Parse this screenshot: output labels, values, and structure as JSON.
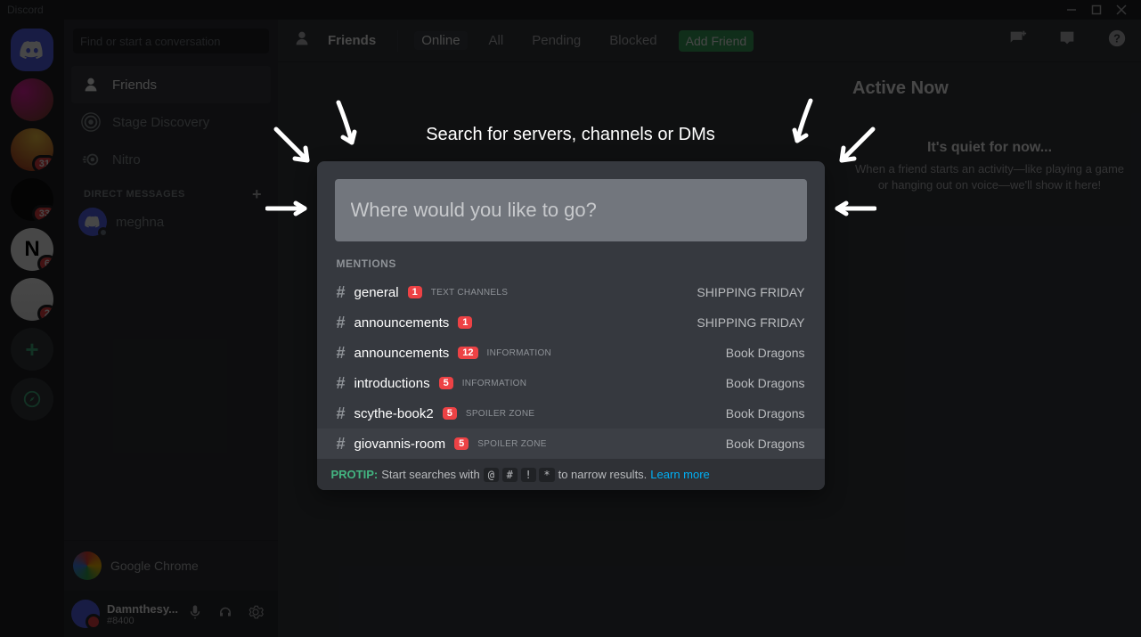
{
  "titlebar": {
    "app_name": "Discord"
  },
  "guilds": [
    {
      "type": "home",
      "badge": null
    },
    {
      "type": "avatar1",
      "badge": null
    },
    {
      "type": "avatar2",
      "badge": "31"
    },
    {
      "type": "avatar-b",
      "label": "",
      "badge": "33"
    },
    {
      "type": "avatar-c",
      "label": "N",
      "badge": "6"
    },
    {
      "type": "stack",
      "badge": "2"
    },
    {
      "type": "add",
      "label": "+"
    },
    {
      "type": "explore",
      "label": ""
    }
  ],
  "sidebar": {
    "search_placeholder": "Find or start a conversation",
    "items": [
      {
        "label": "Friends",
        "selected": true,
        "icon": "friends"
      },
      {
        "label": "Stage Discovery",
        "selected": false,
        "icon": "stage"
      },
      {
        "label": "Nitro",
        "selected": false,
        "icon": "nitro"
      }
    ],
    "dm_header": "DIRECT MESSAGES",
    "dms": [
      {
        "name": "meghna"
      }
    ],
    "activity": {
      "label": "Google Chrome"
    },
    "user": {
      "name": "Damnthesy...",
      "tag": "#8400"
    }
  },
  "toolbar": {
    "title": "Friends",
    "tabs": [
      {
        "label": "Online",
        "active": true
      },
      {
        "label": "All",
        "active": false
      },
      {
        "label": "Pending",
        "active": false
      },
      {
        "label": "Blocked",
        "active": false
      }
    ],
    "add_friend": "Add Friend"
  },
  "right": {
    "heading": "Active Now",
    "quiet_title": "It's quiet for now...",
    "quiet_desc": "When a friend starts an activity—like playing a game or hanging out on voice—we'll show it here!"
  },
  "modal": {
    "title": "Search for servers, channels or DMs",
    "placeholder": "Where would you like to go?",
    "section_label": "MENTIONS",
    "results": [
      {
        "name": "general",
        "badge": "1",
        "category": "TEXT CHANNELS",
        "server": "SHIPPING FRIDAY"
      },
      {
        "name": "announcements",
        "badge": "1",
        "category": "",
        "server": "SHIPPING FRIDAY"
      },
      {
        "name": "announcements",
        "badge": "12",
        "category": "INFORMATION",
        "server": "Book Dragons"
      },
      {
        "name": "introductions",
        "badge": "5",
        "category": "INFORMATION",
        "server": "Book Dragons"
      },
      {
        "name": "scythe-book2",
        "badge": "5",
        "category": "SPOILER ZONE",
        "server": "Book Dragons"
      },
      {
        "name": "giovannis-room",
        "badge": "5",
        "category": "SPOILER ZONE",
        "server": "Book Dragons"
      }
    ],
    "protip_label": "PROTIP:",
    "protip_text_a": "Start searches with",
    "protip_keys": [
      "@",
      "#",
      "!",
      "*"
    ],
    "protip_text_b": "to narrow results.",
    "learn_more": "Learn more"
  }
}
